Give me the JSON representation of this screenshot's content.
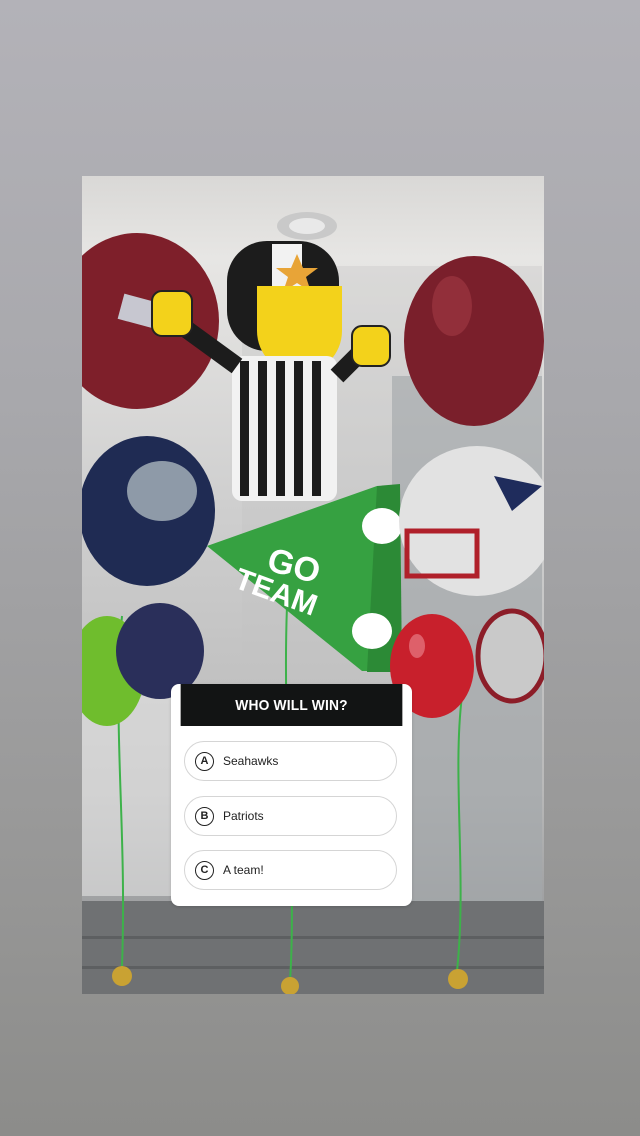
{
  "poll": {
    "question": "WHO WILL WIN?",
    "options": [
      {
        "letter": "A",
        "label": "Seahawks"
      },
      {
        "letter": "B",
        "label": "Patriots"
      },
      {
        "letter": "C",
        "label": "A team!"
      }
    ]
  },
  "photo": {
    "balloon_texts": {
      "megaphone_line1": "GO",
      "megaphone_line2": "TEAM"
    }
  },
  "colors": {
    "poll_header": "#121414",
    "poll_background": "#ffffff",
    "story_background_top": "#b3b2b8",
    "story_background_bottom": "#8c8c8a"
  }
}
